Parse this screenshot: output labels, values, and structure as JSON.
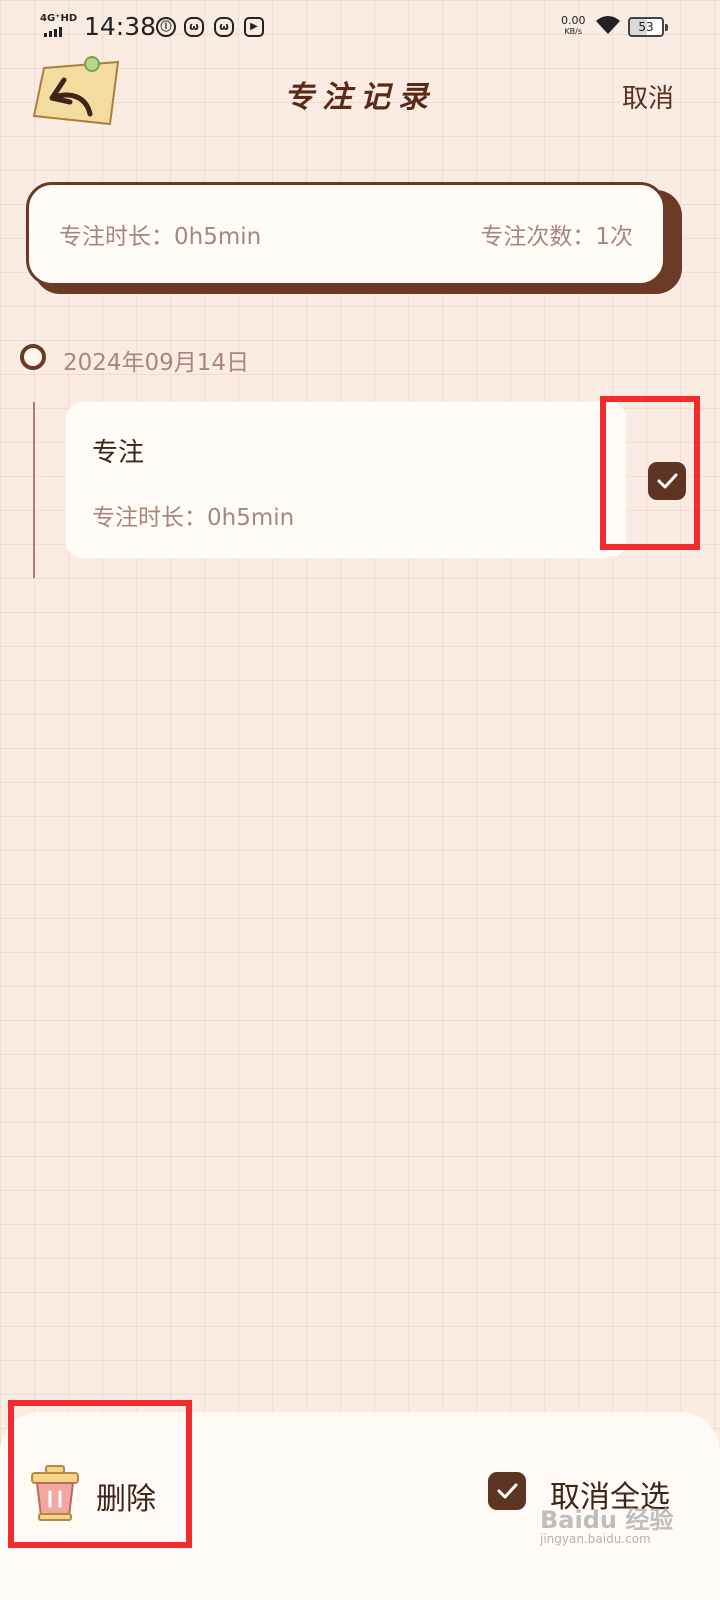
{
  "status_bar": {
    "network": "4G⁺HD",
    "time": "14:38",
    "speed_value": "0.00",
    "speed_unit": "KB/s",
    "battery": "53"
  },
  "header": {
    "title": "专注记录",
    "cancel_label": "取消"
  },
  "summary": {
    "duration_text": "专注时长：0h5min",
    "count_text": "专注次数：1次"
  },
  "timeline": {
    "date": "2024年09月14日",
    "records": [
      {
        "title": "专注",
        "duration_text": "专注时长：0h5min",
        "checked": true
      }
    ]
  },
  "bottom_bar": {
    "delete_label": "删除",
    "deselect_all_label": "取消全选"
  },
  "watermark": {
    "text": "Baidu 经验",
    "url": "jingyan.baidu.com"
  },
  "colors": {
    "accent_brown": "#5e3423",
    "muted_text": "#a8877a",
    "highlight_red": "#f22c2c",
    "background": "#fbece3"
  }
}
